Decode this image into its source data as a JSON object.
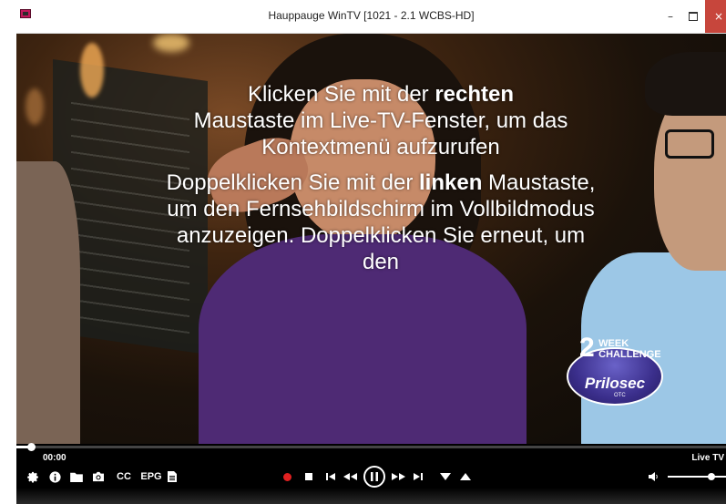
{
  "window": {
    "title": "Hauppauge WinTV [1021 - 2.1  WCBS-HD]",
    "minimize_symbol": "–",
    "close_symbol": "×"
  },
  "overlay": {
    "hint_right_1": "Klicken Sie mit der ",
    "hint_right_bold": "rechten",
    "hint_right_2": "Maustaste im Live-TV-Fenster, um das Kontextmenü aufzurufen",
    "hint_left_1": "Doppelklicken Sie mit der ",
    "hint_left_bold": "linken",
    "hint_left_2": " Maustaste, um den Fernsehbildschirm im Vollbildmodus anzuzeigen. Doppelklicken Sie erneut, um den"
  },
  "ad": {
    "number": "2",
    "line1": "WEEK",
    "line2": "CHALLENGE",
    "brand": "Prilosec",
    "suffix": "OTC"
  },
  "controls": {
    "time": "00:00",
    "mode": "Live TV",
    "cc_label": "CC",
    "epg_label": "EPG",
    "seek_progress": 0.02,
    "volume_level": 0.75,
    "record_color": "#e02020"
  },
  "icons": {
    "settings": "gear-icon",
    "info": "info-icon",
    "folder": "folder-icon",
    "snapshot": "camera-icon",
    "doc": "document-icon",
    "record": "record-icon",
    "stop": "stop-icon",
    "skip_back": "skip-back-icon",
    "rewind": "rewind-icon",
    "pause": "pause-icon",
    "fast_forward": "fast-forward-icon",
    "skip_forward": "skip-forward-icon",
    "channel_down": "channel-down-icon",
    "channel_up": "channel-up-icon",
    "volume": "volume-icon"
  }
}
